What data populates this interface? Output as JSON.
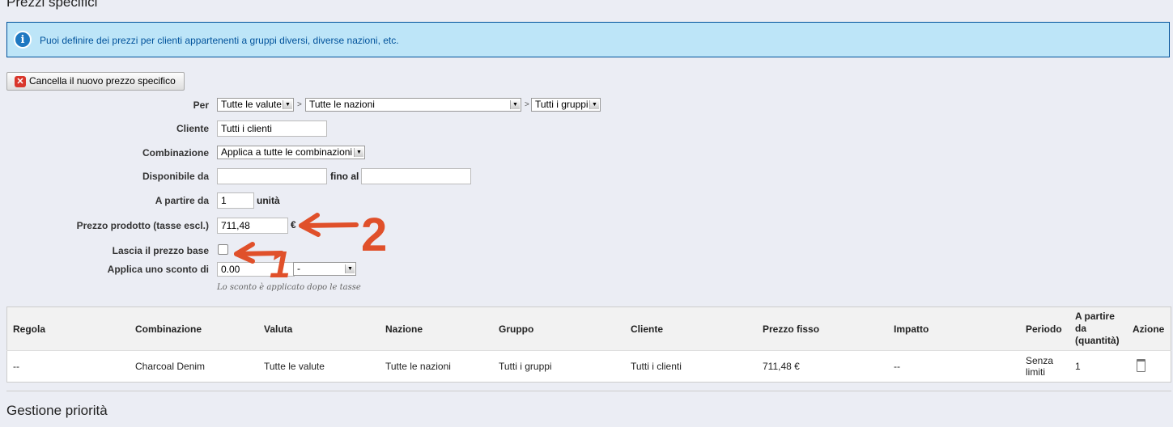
{
  "page": {
    "title": "Prezzi specifici",
    "section2_title": "Gestione priorità"
  },
  "info": {
    "text": "Puoi definire dei prezzi per clienti appartenenti a gruppi diversi, diverse nazioni, etc."
  },
  "toolbar": {
    "cancel_label": "Cancella il nuovo prezzo specifico"
  },
  "form": {
    "per_label": "Per",
    "currency_value": "Tutte le valute",
    "country_value": "Tutte le nazioni",
    "group_value": "Tutti i gruppi",
    "separator": ">",
    "customer_label": "Cliente",
    "customer_value": "Tutti i clienti",
    "combination_label": "Combinazione",
    "combination_value": "Applica a tutte le combinazioni",
    "available_label": "Disponibile da",
    "until_label": "fino al",
    "from_qty_label": "A partire da",
    "from_qty_value": "1",
    "unit_label": "unità",
    "price_label": "Prezzo prodotto (tasse escl.)",
    "price_value": "711,48",
    "currency_symbol": "€",
    "keep_base_label": "Lascia il prezzo base",
    "discount_label": "Applica uno sconto di",
    "discount_value": "0.00",
    "discount_type": "-",
    "hint": "Lo sconto è applicato dopo le tasse"
  },
  "annotations": {
    "one": "1",
    "two": "2",
    "color": "#e0502a"
  },
  "table": {
    "headers": [
      "Regola",
      "Combinazione",
      "Valuta",
      "Nazione",
      "Gruppo",
      "Cliente",
      "Prezzo fisso",
      "Impatto",
      "Periodo",
      "A partire da (quantità)",
      "Azione"
    ],
    "rows": [
      [
        "--",
        "Charcoal Denim",
        "Tutte le valute",
        "Tutte le nazioni",
        "Tutti i gruppi",
        "Tutti i clienti",
        "711,48 €",
        "--",
        "Senza limiti",
        "1",
        ""
      ]
    ]
  }
}
